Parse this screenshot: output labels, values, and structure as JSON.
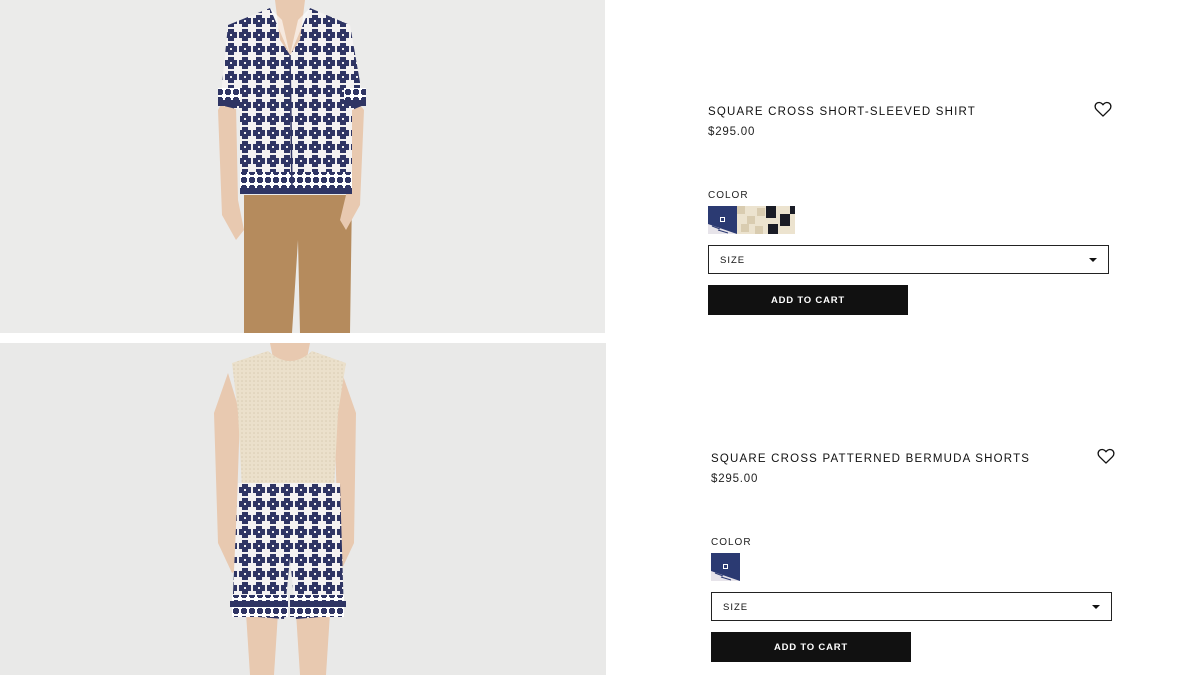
{
  "products": [
    {
      "title": "SQUARE CROSS SHORT-SLEEVED SHIRT",
      "price": "$295.00",
      "color_label": "COLOR",
      "size_label": "SIZE",
      "cta": "ADD TO CART",
      "image_alt": "Model wearing square cross short-sleeved shirt with camel trousers",
      "swatches": [
        "navy-print",
        "ecru-print",
        "black-ecru-check"
      ],
      "selected_swatch": "navy-print"
    },
    {
      "title": "SQUARE CROSS PATTERNED BERMUDA SHORTS",
      "price": "$295.00",
      "color_label": "COLOR",
      "size_label": "SIZE",
      "cta": "ADD TO CART",
      "image_alt": "Model wearing ecru knit tank top with square cross patterned bermuda shorts",
      "swatches": [
        "navy-print"
      ],
      "selected_swatch": "navy-print"
    }
  ],
  "icons": {
    "wishlist": "heart-outline-icon",
    "dropdown": "caret-down-icon"
  },
  "colors": {
    "accent": "#111111",
    "background": "#ffffff",
    "image_bg": "#ebebea",
    "navy": "#2a2f5c",
    "ecru": "#ece3cf"
  }
}
